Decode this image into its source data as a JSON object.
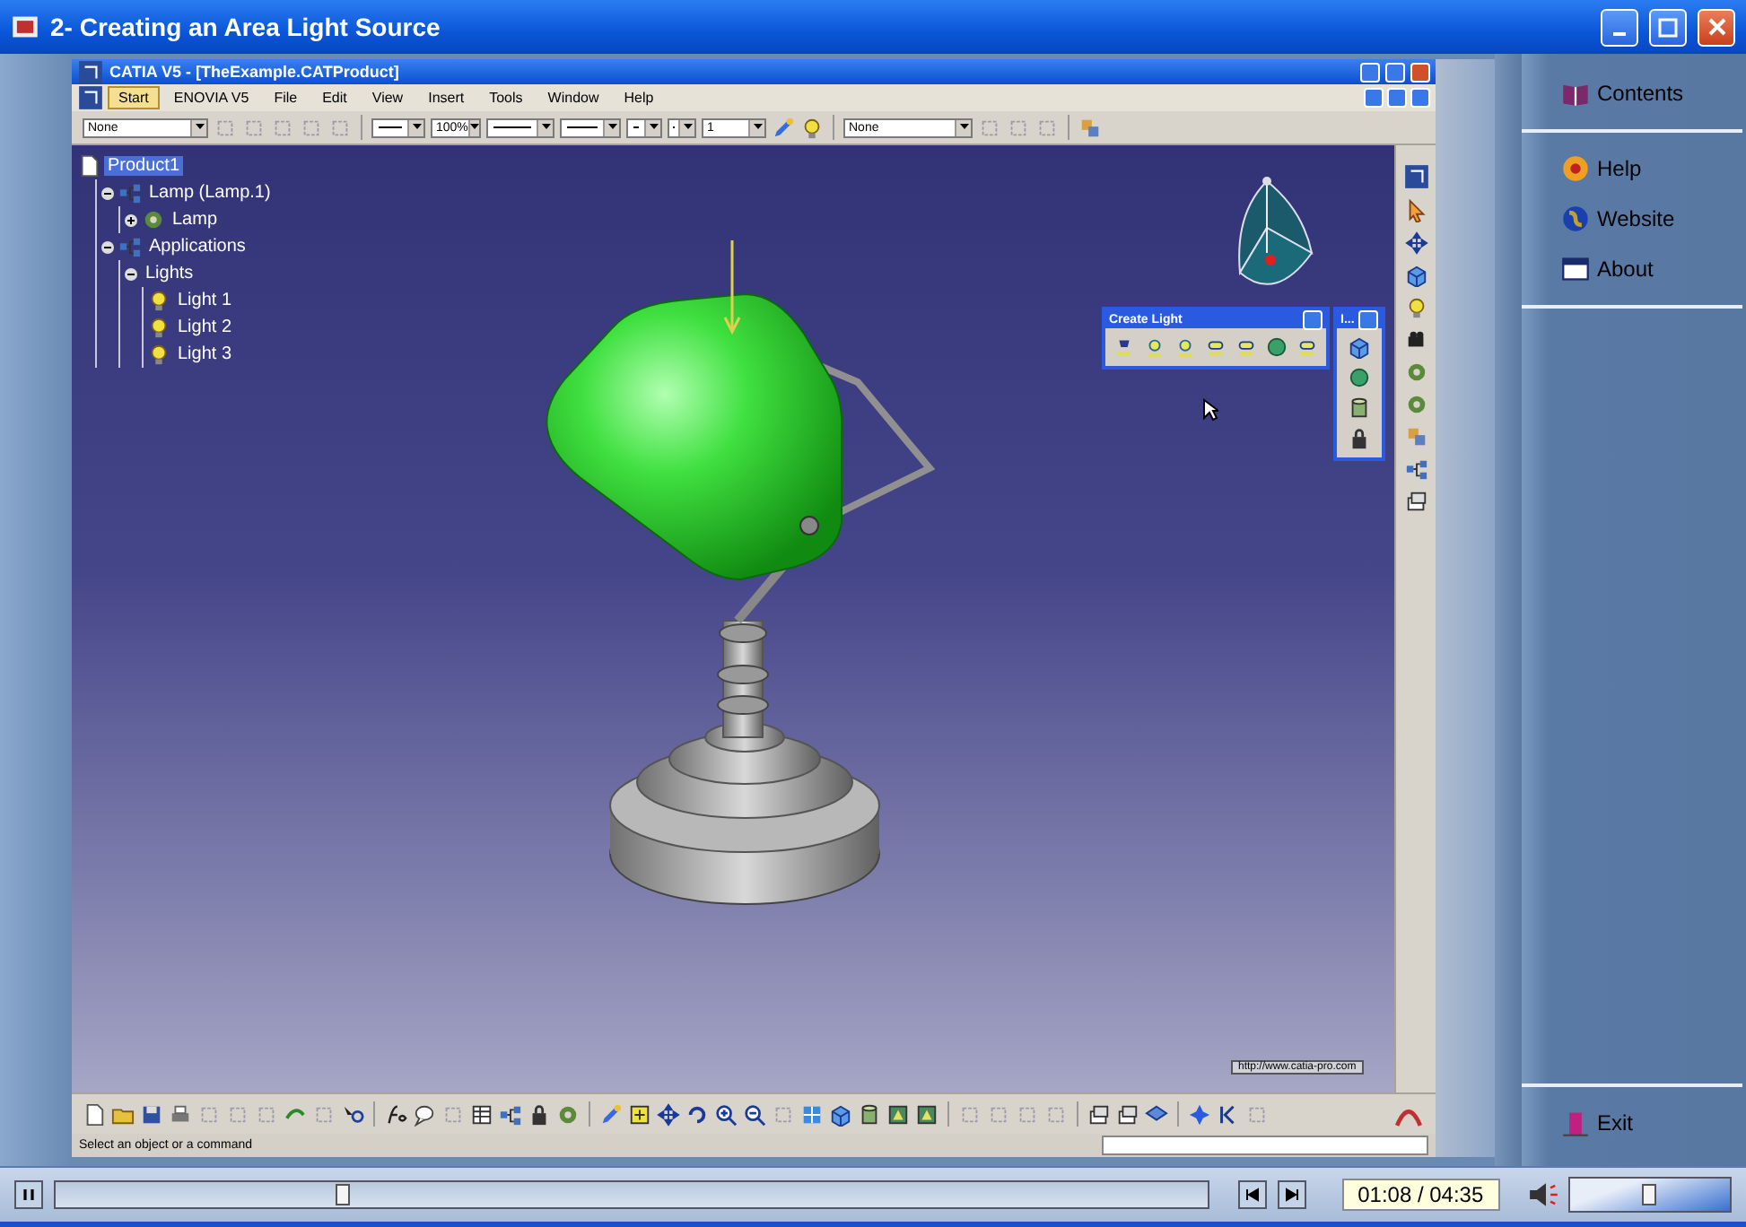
{
  "window": {
    "title": "2- Creating an Area Light Source"
  },
  "catia": {
    "title": "CATIA V5 - [TheExample.CATProduct]",
    "menu": [
      {
        "label": "Start",
        "selected": true
      },
      {
        "label": "ENOVIA V5",
        "selected": false
      },
      {
        "label": "File",
        "selected": false
      },
      {
        "label": "Edit",
        "selected": false
      },
      {
        "label": "View",
        "selected": false
      },
      {
        "label": "Insert",
        "selected": false
      },
      {
        "label": "Tools",
        "selected": false
      },
      {
        "label": "Window",
        "selected": false
      },
      {
        "label": "Help",
        "selected": false
      }
    ],
    "toolbar_combos": [
      "None",
      "100%",
      "1",
      "None"
    ],
    "tree": [
      {
        "label": "Product1",
        "selected": true,
        "children": [
          {
            "label": "Lamp (Lamp.1)",
            "selected": false,
            "expanded": true,
            "children": [
              {
                "label": "Lamp",
                "selected": false,
                "expanded": false
              }
            ]
          },
          {
            "label": "Applications",
            "selected": false,
            "expanded": true,
            "children": [
              {
                "label": "Lights",
                "selected": false,
                "expanded": true,
                "children": [
                  {
                    "label": "Light 1",
                    "selected": false
                  },
                  {
                    "label": "Light 2",
                    "selected": false
                  },
                  {
                    "label": "Light 3",
                    "selected": false
                  }
                ]
              }
            ]
          }
        ]
      }
    ],
    "create_light_toolbar": {
      "title": "Create Light"
    },
    "small_toolbar": {
      "title": "I..."
    },
    "url_label": "http://www.catia-pro.com",
    "status": "Select an object or a command"
  },
  "sidebar": {
    "items": [
      {
        "label": "Contents"
      },
      {
        "label": "Help"
      },
      {
        "label": "Website"
      },
      {
        "label": "About"
      }
    ],
    "exit": {
      "label": "Exit"
    }
  },
  "player": {
    "seek": {
      "level": 0.25
    },
    "time": "01:08 / 04:35",
    "volume": {
      "level": 0.5
    }
  }
}
